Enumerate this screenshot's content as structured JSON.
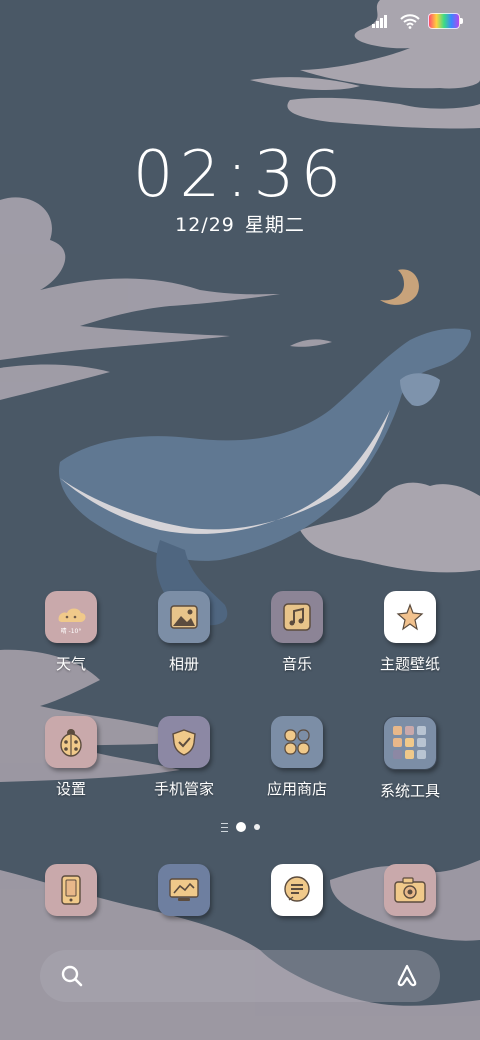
{
  "status_bar": {
    "signal_icon": "signal-icon",
    "wifi_icon": "wifi-icon",
    "battery_icon": "battery-icon"
  },
  "clock": {
    "time": "02:36",
    "date": "12/29",
    "weekday": "星期二"
  },
  "apps": [
    {
      "name": "天气",
      "icon": "weather-icon",
      "color": "#c9a9ab",
      "badge": "晴 -10°"
    },
    {
      "name": "相册",
      "icon": "gallery-icon",
      "color": "#7c8ea6"
    },
    {
      "name": "音乐",
      "icon": "music-icon",
      "color": "#8c8496"
    },
    {
      "name": "主题壁纸",
      "icon": "theme-icon",
      "color": "#ffffff"
    },
    {
      "name": "设置",
      "icon": "ladybug-settings-icon",
      "color": "#c9a9ab"
    },
    {
      "name": "手机管家",
      "icon": "shield-icon",
      "color": "#8c88a4"
    },
    {
      "name": "应用商店",
      "icon": "app-store-icon",
      "color": "#7c8ea6"
    },
    {
      "name": "系统工具",
      "icon": "folder-icon",
      "color": "#7c8ea6"
    }
  ],
  "dock": [
    {
      "icon": "phone-icon",
      "color": "#c9a9ab"
    },
    {
      "icon": "browser-icon",
      "color": "#6e7fa0"
    },
    {
      "icon": "messages-icon",
      "color": "#ffffff"
    },
    {
      "icon": "camera-icon",
      "color": "#c9a9ab"
    }
  ],
  "page_indicator": {
    "pages": 2,
    "active": 1
  },
  "search_bar": {
    "search_icon": "search-icon",
    "assistant_icon": "assistant-icon"
  }
}
